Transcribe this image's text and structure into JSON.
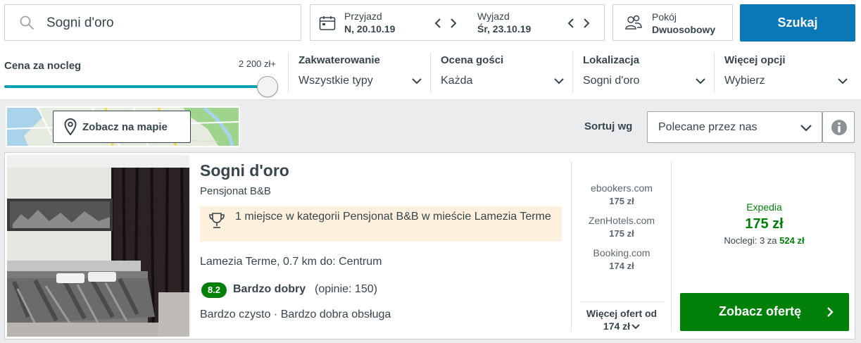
{
  "search": {
    "destination_value": "Sogni d'oro",
    "checkin_label": "Przyjazd",
    "checkin_value": "N, 20.10.19",
    "checkout_label": "Wyjazd",
    "checkout_value": "Śr, 23.10.19",
    "room_label": "Pokój",
    "room_value": "Dwuosobowy",
    "submit_label": "Szukaj"
  },
  "filters": {
    "price": {
      "title": "Cena za nocleg",
      "max_label": "2 200 zł+",
      "slider_fraction": 1.0
    },
    "columns": [
      {
        "title": "Zakwaterowanie",
        "value": "Wszystkie typy"
      },
      {
        "title": "Ocena gości",
        "value": "Każda"
      },
      {
        "title": "Lokalizacja",
        "value": "Sogni d'oro"
      },
      {
        "title": "Więcej opcji",
        "value": "Wybierz"
      }
    ]
  },
  "map": {
    "button_label": "Zobacz na mapie"
  },
  "sort": {
    "label": "Sortuj wg",
    "value": "Polecane przez nas"
  },
  "result": {
    "name": "Sogni d'oro",
    "type": "Pensjonat B&B",
    "award": "1 miejsce w kategorii Pensjonat B&B w mieście Lamezia Terme",
    "location": "Lamezia Terme, 0.7 km do: Centrum",
    "rating_score": "8.2",
    "rating_text": "Bardzo dobry",
    "rating_count": "(opinie: 150)",
    "highlights": "Bardzo czysto · Bardzo dobra obsługa",
    "offers": [
      {
        "site": "ebookers.com",
        "price": "175 zł"
      },
      {
        "site": "ZenHotels.com",
        "price": "175 zł"
      },
      {
        "site": "Booking.com",
        "price": "174 zł"
      }
    ],
    "more_offers_label": "Więcej ofert od",
    "more_offers_price": "174 zł",
    "best_offer": {
      "site": "Expedia",
      "price": "175 zł",
      "nights_prefix": "Noclegi: 3 za",
      "nights_total": "524 zł"
    },
    "deal_button_label": "Zobacz ofertę"
  },
  "colors": {
    "primary_blue": "#0a77b7",
    "deal_green": "#008009",
    "slider_teal": "#0aa0b4",
    "award_bg": "#fdf0dc"
  }
}
